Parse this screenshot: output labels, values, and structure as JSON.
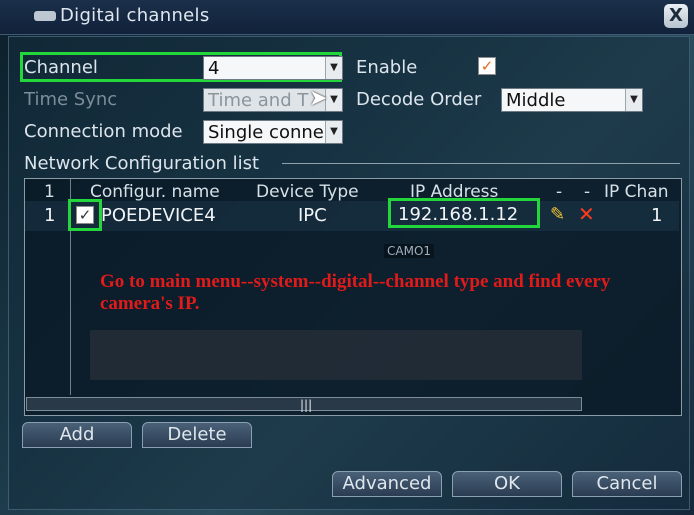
{
  "window": {
    "title": "Digital channels",
    "close_label": "X"
  },
  "form": {
    "channel_label": "Channel",
    "channel_value": "4",
    "enable_label": "Enable",
    "enable_checked": true,
    "time_sync_label": "Time Sync",
    "time_sync_value": "Time and T",
    "decode_order_label": "Decode Order",
    "decode_order_value": "Middle",
    "connection_mode_label": "Connection mode",
    "connection_mode_value": "Single conne",
    "network_list_label": "Network Configuration list"
  },
  "table": {
    "columns": [
      "1",
      "Configur. name",
      "Device Type",
      "IP Address",
      "-",
      "-",
      "IP Chan"
    ],
    "rows": [
      {
        "index": "1",
        "checked": true,
        "name": "POEDEVICE4",
        "type": "IPC",
        "ip": "192.168.1.12",
        "chan": "1"
      }
    ]
  },
  "overlay": {
    "camera_label": "CAMO1",
    "annotation": "Go to main menu--system--digital--channel type and find every camera's IP."
  },
  "buttons": {
    "add": "Add",
    "delete": "Delete",
    "advanced": "Advanced",
    "ok": "OK",
    "cancel": "Cancel"
  },
  "colors": {
    "highlight": "#22d63b",
    "annotation": "#e11a1a"
  }
}
